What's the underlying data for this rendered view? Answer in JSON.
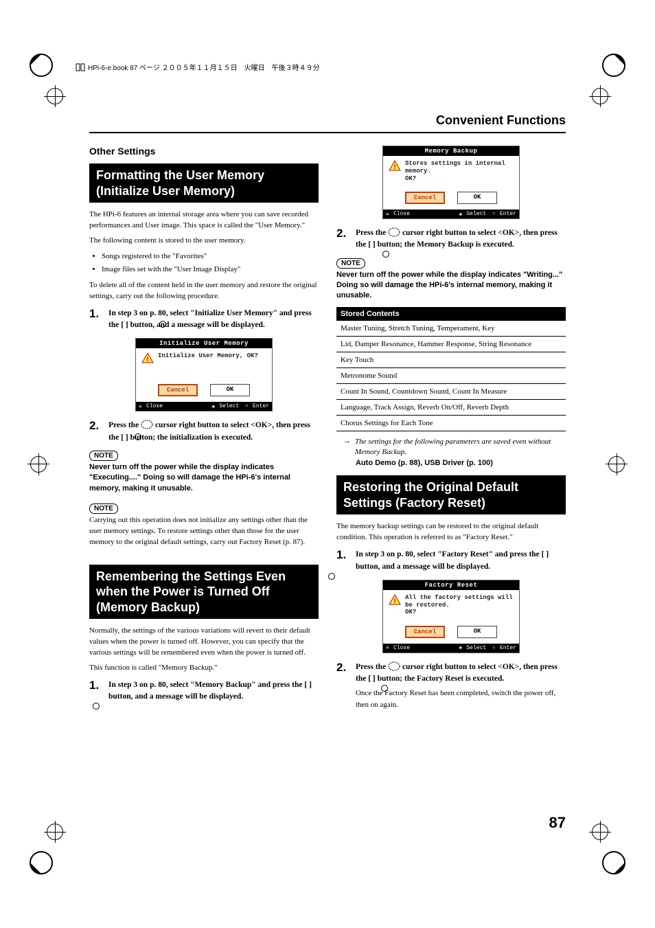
{
  "header_strip": "HPi-6-e.book 87 ページ ２００５年１１月１５日　火曜日　午後３時４９分",
  "running_head": "Convenient Functions",
  "subhead_other": "Other Settings",
  "left": {
    "sec1": {
      "title": "Formatting the User Memory (Initialize User Memory)",
      "p1": "The HPi-6 features an internal storage area where you can save recorded performances and User image. This space is called the \"User Memory.\"",
      "p2": "The following content is stored to the user memory.",
      "b1": "Songs registered to the \"Favorites\"",
      "b2": "Image files set with the \"User Image Display\"",
      "p3": "To delete all of the content held in the user memory and restore the original settings, carry out the following procedure.",
      "step1": "In step 3 on p. 80, select \"Initialize User Memory\" and press the [      ] button, and a message will be displayed.",
      "dialog": {
        "title": "Initialize User Memory",
        "msg": "Initialize User Memory, OK?",
        "cancel": "Cancel",
        "ok": "OK",
        "close": "Close",
        "select": "Select",
        "enter": "Enter"
      },
      "step2a": "Press the ",
      "step2b": " cursor right button to select <OK>, then press the [      ] button; the initialization is executed.",
      "note1": "Never turn off the power while the display indicates \"Executing....\" Doing so will damage the HPi-6's internal memory, making it unusable.",
      "note2": "Carrying out this operation does not initialize any settings other than the user memory settings. To restore settings other than those for the user memory to the original default settings, carry out Factory Reset (p. 87)."
    },
    "sec2": {
      "title": "Remembering the Settings Even when the Power is Turned Off (Memory Backup)",
      "p1": "Normally, the settings of the various variations will revert to their default values when the power is turned off. However, you can specify that the various settings will be remembered even when the power is turned off.",
      "p2": "This function is called \"Memory Backup.\"",
      "step1": "In step 3 on p. 80, select \"Memory Backup\" and press the [      ] button, and a message will be displayed."
    }
  },
  "right": {
    "dialog1": {
      "title": "Memory Backup",
      "msg": "Stores settings in internal memory.\nOK?",
      "cancel": "Cancel",
      "ok": "OK",
      "close": "Close",
      "select": "Select",
      "enter": "Enter"
    },
    "step2a": "Press the ",
    "step2b": " cursor right button to select <OK>, then press the [      ] button; the Memory Backup is executed.",
    "note1": "Never turn off the power while the display indicates \"Writing...\" Doing so will damage the HPi-6's internal memory, making it unusable.",
    "table": {
      "head": "Stored Contents",
      "r1": "Master Tuning, Stretch Tuning, Temperament, Key",
      "r2": "Lid, Damper Resonance, Hammer Response, String Resonance",
      "r3": "Key Touch",
      "r4": "Metronome Sound",
      "r5": "Count In Sound, Countdown Sound, Count In Measure",
      "r6": "Language, Track Assign, Reverb On/Off, Reverb Depth",
      "r7": "Chorus Settings for Each Tone"
    },
    "arrow_note": "The settings for the following parameters are saved even without Memory Backup.",
    "bold_ref": "Auto Demo (p. 88), USB Driver (p. 100)",
    "sec3": {
      "title": "Restoring the Original Default Settings (Factory Reset)",
      "p1": "The memory backup settings can be restored to the original default condition. This operation is referred to as \"Factory Reset.\"",
      "step1": "In step 3 on p. 80, select \"Factory Reset\" and press the [      ] button, and a message will be displayed.",
      "dialog": {
        "title": "Factory Reset",
        "msg": "All the factory settings will be restored.\nOK?",
        "cancel": "Cancel",
        "ok": "OK",
        "close": "Close",
        "select": "Select",
        "enter": "Enter"
      },
      "step2a": "Press the ",
      "step2b": " cursor right button to select <OK>, then press the [      ] button; the Factory Reset is executed.",
      "p2": "Once the Factory Reset has been completed, switch the power off, then on again."
    }
  },
  "note_label": "NOTE",
  "page_number": "87"
}
